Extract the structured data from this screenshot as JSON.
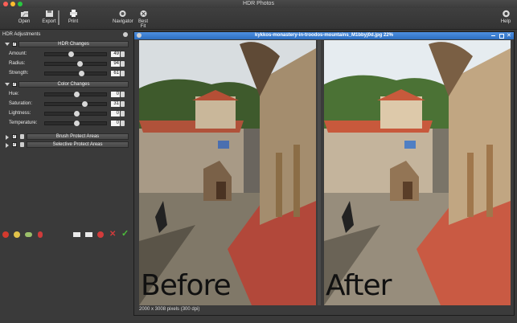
{
  "window": {
    "title": "HDR Photos"
  },
  "toolbar": {
    "open": "Open",
    "export": "Export",
    "print": "Print",
    "navigator": "Navigator",
    "best_fit": "Best Fit",
    "help": "Help"
  },
  "sidebar": {
    "title": "HDR Adjustments",
    "hdr_changes": {
      "label": "HDR Changes",
      "rows": [
        {
          "label": "Amount:",
          "value": "49",
          "level": 0.49
        },
        {
          "label": "Radius:",
          "value": "94",
          "level": 0.55
        },
        {
          "label": "Strength:",
          "value": "61",
          "level": 0.61
        }
      ]
    },
    "color_changes": {
      "label": "Color Changes",
      "rows": [
        {
          "label": "Hue:",
          "value": "0",
          "level": 0.5
        },
        {
          "label": "Saturation:",
          "value": "31",
          "level": 0.65
        },
        {
          "label": "Lightness:",
          "value": "0",
          "level": 0.5
        },
        {
          "label": "Temperature:",
          "value": "0",
          "level": 0.5
        }
      ]
    },
    "brush_protect": "Brush Protect Areas",
    "selective_protect": "Selective Protect Areas"
  },
  "document": {
    "filename": "kykkos-monastery-in-troodos-mountains_M1bbyj0d.jpg 22%",
    "status": "2000 x 3008 pixels (300 dpi)",
    "before_label": "Before",
    "after_label": "After"
  },
  "colors": {
    "accent_blue": "#3b7fd4",
    "panel_bg": "#3a3a3a",
    "roof_red": "#b8452c",
    "sky": "#e6ecf0"
  }
}
